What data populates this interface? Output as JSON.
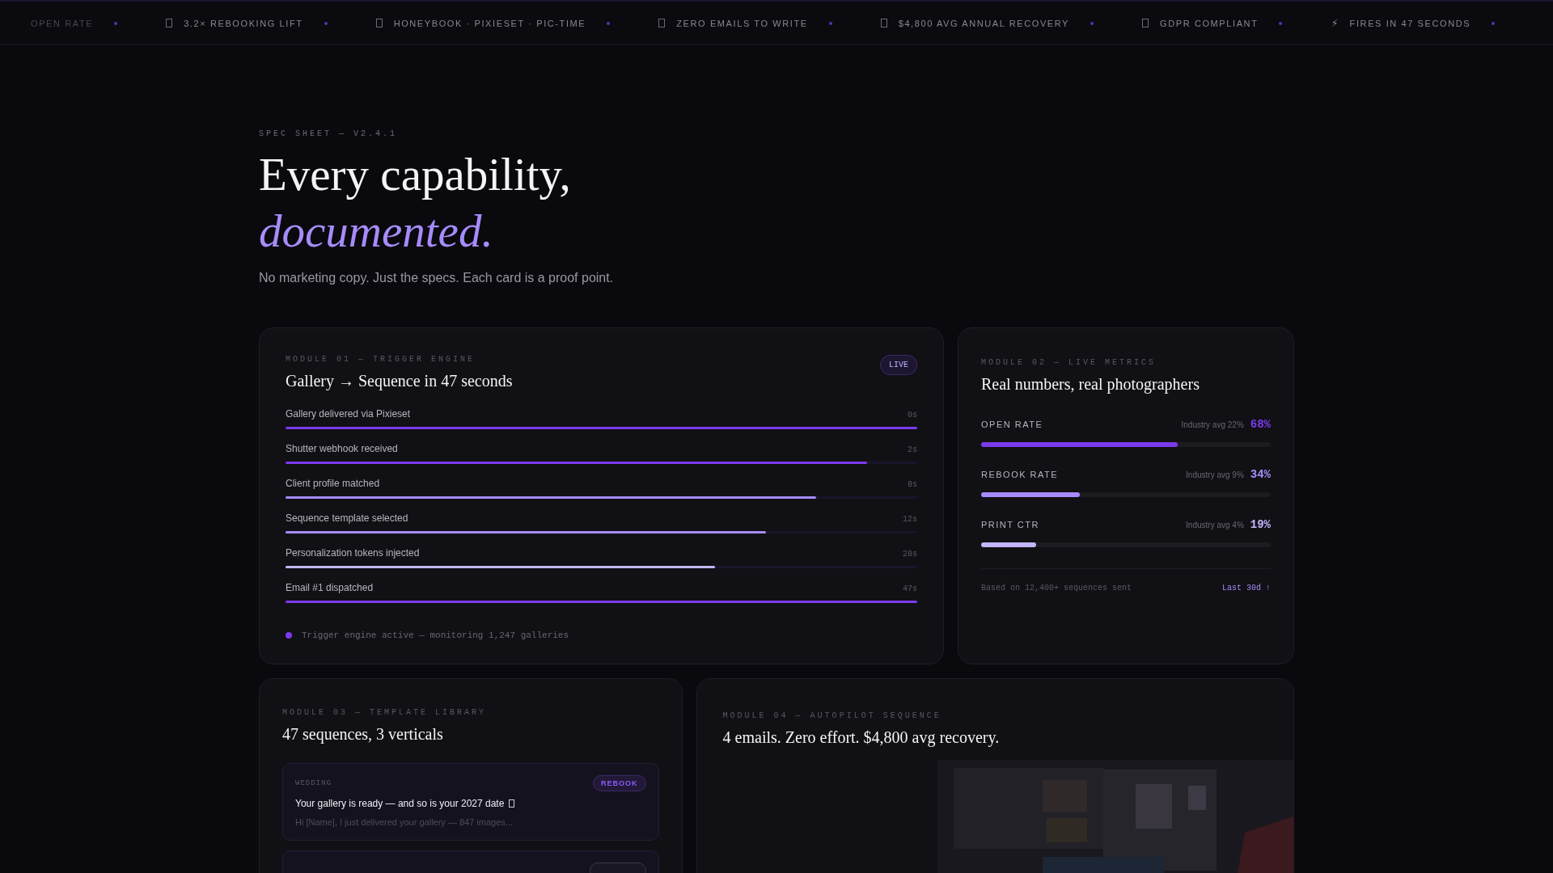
{
  "ticker": [
    {
      "label": "OPEN RATE",
      "kind": "cut"
    },
    {
      "label": "3.2× REBOOKING LIFT",
      "kind": "boxed"
    },
    {
      "label": "HONEYBOOK · PIXIESET · PIC-TIME",
      "kind": "boxed"
    },
    {
      "label": "ZERO EMAILS TO WRITE",
      "kind": "boxed"
    },
    {
      "label": "$4,800 AVG ANNUAL RECOVERY",
      "kind": "boxed"
    },
    {
      "label": "GDPR COMPLIANT",
      "kind": "boxed"
    },
    {
      "label": "FIRES IN 47 SECONDS",
      "kind": "glyph",
      "glyph": "⚡"
    }
  ],
  "hero": {
    "eyebrow": "SPEC SHEET — V2.4.1",
    "title": "Every capability,",
    "title_accent": "documented.",
    "subtitle": "No marketing copy. Just the specs. Each card is a proof point."
  },
  "trigger_card": {
    "module": "MODULE 01 — TRIGGER ENGINE",
    "badge": "LIVE",
    "title": "Gallery → Sequence in 47 seconds",
    "steps": [
      {
        "label": "Gallery delivered via Pixieset",
        "time": "0s",
        "level": 1.0,
        "color": "#7c3aed"
      },
      {
        "label": "Shutter webhook received",
        "time": "2s",
        "level": 0.92,
        "color": "#7c3aed"
      },
      {
        "label": "Client profile matched",
        "time": "8s",
        "level": 0.84,
        "color": "#a78bfa"
      },
      {
        "label": "Sequence template selected",
        "time": "12s",
        "level": 0.76,
        "color": "#a78bfa"
      },
      {
        "label": "Personalization tokens injected",
        "time": "28s",
        "level": 0.68,
        "color": "#c4b5fd"
      },
      {
        "label": "Email #1 dispatched",
        "time": "47s",
        "level": 1.0,
        "color": "#7c3aed"
      }
    ],
    "status": "Trigger engine active — monitoring 1,247 galleries"
  },
  "metrics_card": {
    "module": "MODULE 02 — LIVE METRICS",
    "title": "Real numbers, real photographers",
    "metrics": [
      {
        "name": "OPEN RATE",
        "benchmark": "Industry avg 22%",
        "value": "68%",
        "level": 0.68,
        "color": "#7c3aed"
      },
      {
        "name": "REBOOK RATE",
        "benchmark": "Industry avg 9%",
        "value": "34%",
        "level": 0.34,
        "color": "#a78bfa"
      },
      {
        "name": "PRINT CTR",
        "benchmark": "Industry avg 4%",
        "value": "19%",
        "level": 0.19,
        "color": "#c4b5fd"
      }
    ],
    "footnote": "Based on 12,400+ sequences sent",
    "period": "Last 30d ↑"
  },
  "template_card": {
    "module": "MODULE 03 — TEMPLATE LIBRARY",
    "title": "47 sequences, 3 verticals",
    "templates": [
      {
        "kind": "full",
        "vertical": "WEDDING",
        "tag": "REBOOK",
        "subject": "Your gallery is ready — and so is your 2027 date",
        "preview": "Hi [Name], I just delivered your gallery — 847 images..."
      },
      {
        "kind": "partial"
      }
    ]
  },
  "autopilot_card": {
    "module": "MODULE 04 — AUTOPILOT SEQUENCE",
    "title": "4 emails. Zero effort. $4,800 avg recovery."
  }
}
